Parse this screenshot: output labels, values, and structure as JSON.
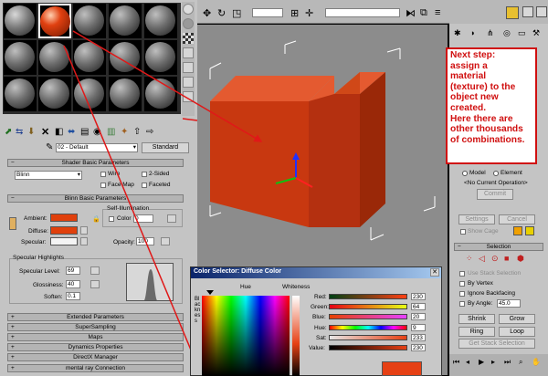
{
  "material_editor": {
    "material_name": "02 - Default",
    "material_type": "Standard",
    "rollouts": {
      "shader_basic": "Shader Basic Parameters",
      "blinn_basic": "Blinn Basic Parameters",
      "extended": "Extended Parameters",
      "supersampling": "SuperSampling",
      "maps": "Maps",
      "dynamics": "Dynamics Properties",
      "directx": "DirectX Manager",
      "mental_ray": "mental ray Connection"
    },
    "shader": {
      "selected": "Blinn",
      "wire": "Wire",
      "two_sided": "2-Sided",
      "face_map": "Face Map",
      "faceted": "Faceted"
    },
    "blinn": {
      "ambient": "Ambient:",
      "diffuse": "Diffuse:",
      "specular": "Specular:",
      "self_illum_title": "Self-Illumination",
      "color_label": "Color",
      "color_value": "0",
      "opacity_label": "Opacity:",
      "opacity_value": "100",
      "ambient_color": "#e0400c",
      "diffuse_color": "#e0400c",
      "specular_color": "#f4f4f4"
    },
    "specular_highlights": {
      "title": "Specular Highlights",
      "level_label": "Specular Level:",
      "level_value": "69",
      "gloss_label": "Glossiness:",
      "gloss_value": "40",
      "soften_label": "Soften:",
      "soften_value": "0.1"
    }
  },
  "note": {
    "text": "Next step:\nassign a\nmaterial\n(texture) to the\nobject new\ncreated.\nHere there are\nother thousands\nof combinations."
  },
  "right_panel": {
    "model_label": "Model",
    "element_label": "Element",
    "no_op": "<No Current Operation>",
    "commit": "Commit",
    "settings": "Settings",
    "cancel": "Cancel",
    "show_cage": "Show Cage",
    "selection_title": "Selection",
    "use_stack": "Use Stack Selection",
    "by_vertex": "By Vertex",
    "ignore_backfacing": "Ignore Backfacing",
    "by_angle": "By Angle:",
    "by_angle_value": "45.0",
    "shrink": "Shrink",
    "grow": "Grow",
    "ring": "Ring",
    "loop": "Loop",
    "get_stack": "Get Stack Selection"
  },
  "color_selector": {
    "title": "Color Selector: Diffuse Color",
    "hue_label": "Hue",
    "whiteness_label": "Whiteness",
    "blackness_label": "Blackness",
    "red": {
      "label": "Red:",
      "value": "230"
    },
    "green": {
      "label": "Green:",
      "value": "64"
    },
    "blue": {
      "label": "Blue:",
      "value": "20"
    },
    "hue": {
      "label": "Hue:",
      "value": "9"
    },
    "sat": {
      "label": "Sat:",
      "value": "233"
    },
    "val": {
      "label": "Value:",
      "value": "230"
    },
    "current_color": "#e64014"
  },
  "colors": {
    "viewport_bg": "#8c8c8c",
    "box_color": "#c83810",
    "arrow_red": "#e01818"
  }
}
